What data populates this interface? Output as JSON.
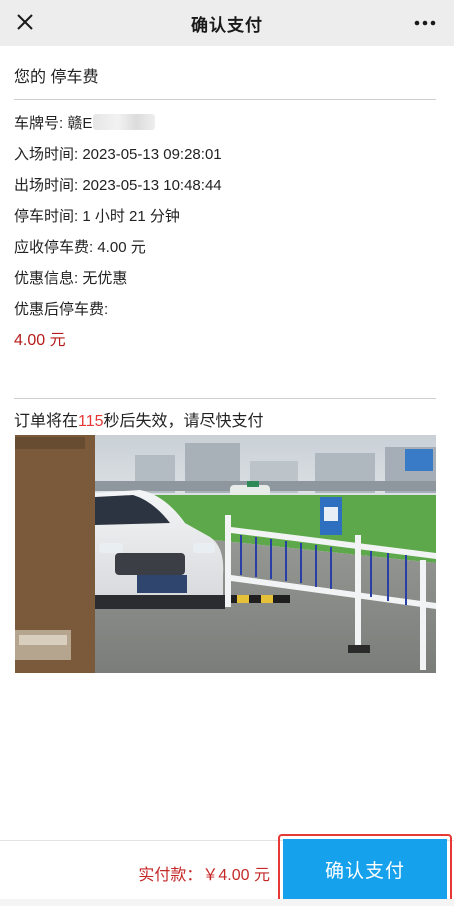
{
  "header": {
    "title": "确认支付",
    "close_icon": "close-icon",
    "more_icon": "more-icon"
  },
  "section": {
    "title": "您的 停车费"
  },
  "details": {
    "plate_label": "车牌号: ",
    "plate_value": "赣E",
    "entry_label": "入场时间: ",
    "entry_value": "2023-05-13 09:28:01",
    "exit_label": "出场时间: ",
    "exit_value": "2023-05-13 10:48:44",
    "duration_label": "停车时间: ",
    "duration_value": "1 小时 21 分钟",
    "fee_label": "应收停车费: ",
    "fee_value": "4.00 元",
    "discount_label": "优惠信息: ",
    "discount_value": "无优惠",
    "fee_after_label": "优惠后停车费:",
    "fee_after_value": "4.00 元"
  },
  "countdown": {
    "prefix": "订单将在",
    "seconds": "115",
    "suffix": "秒后失效，请尽快支付"
  },
  "footer": {
    "paid_label": "实付款：",
    "paid_value": "￥4.00 元",
    "pay_button": "确认支付"
  },
  "colors": {
    "accent": "#15a1ec",
    "price": "#b71c1c",
    "highlight_border": "#e53935"
  }
}
